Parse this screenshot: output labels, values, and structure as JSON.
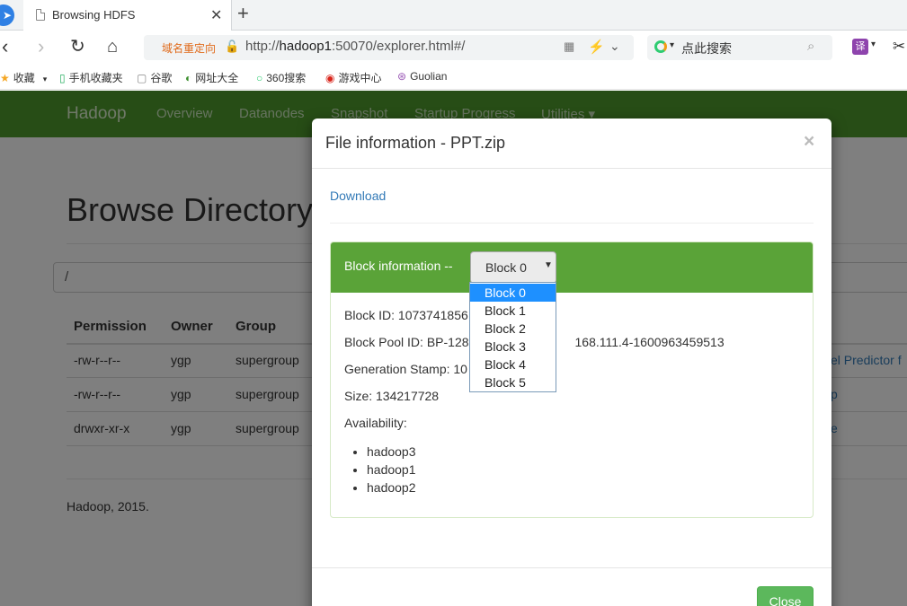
{
  "browser": {
    "tab_title": "Browsing HDFS",
    "redirect_label": "域名重定向",
    "url_prefix": "http://",
    "url_host": "hadoop1",
    "url_rest": ":50070/explorer.html#/",
    "search_placeholder": "点此搜索",
    "translate_label": "译"
  },
  "bookmarks": [
    {
      "icon": "★",
      "label": "收藏"
    },
    {
      "icon": "▯",
      "label": "手机收藏夹"
    },
    {
      "icon": "▢",
      "label": "谷歌"
    },
    {
      "icon": "◐",
      "label": "网址大全"
    },
    {
      "icon": "○",
      "label": "360搜索"
    },
    {
      "icon": "◉",
      "label": "游戏中心"
    },
    {
      "icon": "⊛",
      "label": "Guolian"
    }
  ],
  "navbar": {
    "brand": "Hadoop",
    "links": [
      "Overview",
      "Datanodes",
      "Snapshot",
      "Startup Progress",
      "Utilities ▾"
    ]
  },
  "page": {
    "title": "Browse Directory",
    "path": "/",
    "columns": [
      "Permission",
      "Owner",
      "Group"
    ],
    "rows": [
      {
        "permission": "-rw-r--r--",
        "owner": "ygp",
        "group": "supergroup",
        "name_fragment": "el Predictor f"
      },
      {
        "permission": "-rw-r--r--",
        "owner": "ygp",
        "group": "supergroup",
        "name_fragment": "p"
      },
      {
        "permission": "drwxr-xr-x",
        "owner": "ygp",
        "group": "supergroup",
        "name_fragment": "e"
      }
    ],
    "footer": "Hadoop, 2015."
  },
  "modal": {
    "title": "File information - PPT.zip",
    "download": "Download",
    "block_label": "Block information --",
    "selected_block": "Block 0",
    "block_options": [
      "Block 0",
      "Block 1",
      "Block 2",
      "Block 3",
      "Block 4",
      "Block 5"
    ],
    "block_id": "Block ID: 1073741856",
    "block_pool": "Block Pool ID: BP-128",
    "block_pool_tail": "168.111.4-1600963459513",
    "generation": "Generation Stamp: 10",
    "size": "Size: 134217728",
    "availability": "Availability:",
    "hosts": [
      "hadoop3",
      "hadoop1",
      "hadoop2"
    ],
    "close": "Close"
  },
  "colors": {
    "navbar": "#4e9a2c",
    "panel_header": "#5aa338",
    "link": "#337ab7",
    "close_button": "#5cb85c",
    "selected_option": "#1e90ff"
  }
}
